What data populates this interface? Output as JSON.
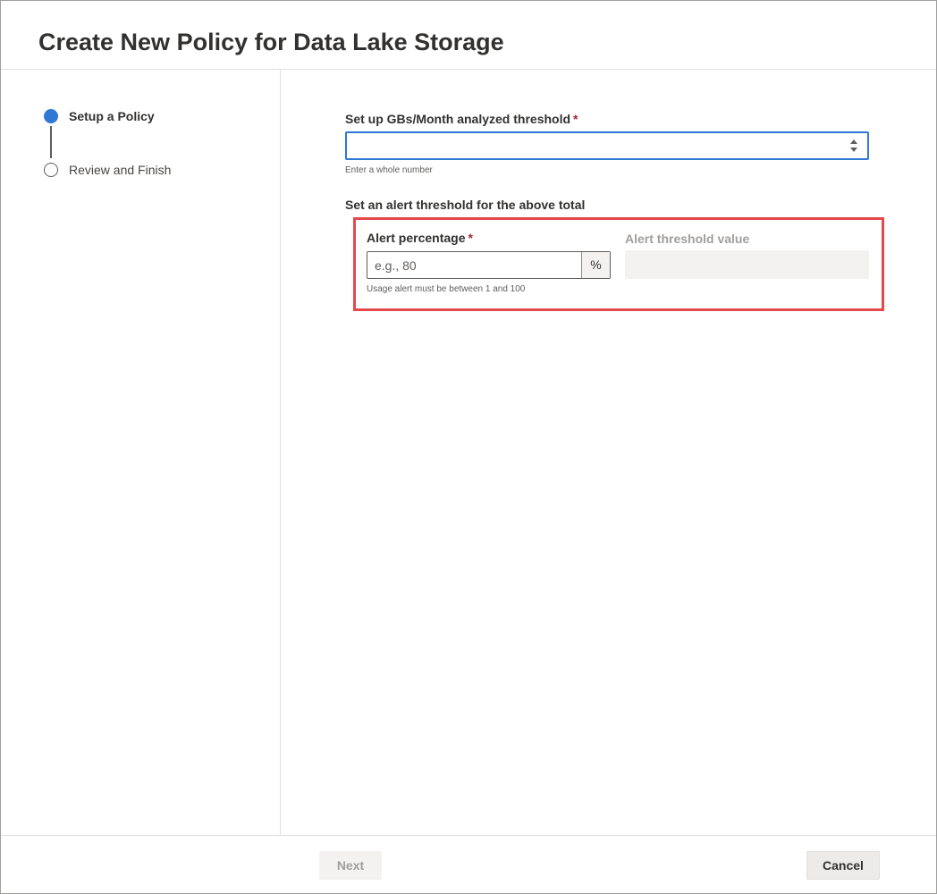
{
  "dialog": {
    "title": "Create New Policy for Data Lake Storage"
  },
  "steps": [
    {
      "label": "Setup a Policy",
      "state": "active"
    },
    {
      "label": "Review and Finish",
      "state": "pending"
    }
  ],
  "form": {
    "gb_threshold": {
      "label": "Set up GBs/Month analyzed threshold",
      "required_marker": "*",
      "value": "",
      "hint": "Enter a whole number"
    },
    "alert_section_title": "Set an alert threshold for the above total",
    "alert_percentage": {
      "label": "Alert percentage",
      "required_marker": "*",
      "placeholder": "e.g., 80",
      "suffix": "%",
      "hint": "Usage alert must be between 1 and 100"
    },
    "alert_threshold_value": {
      "label": "Alert threshold value",
      "value": ""
    }
  },
  "footer": {
    "next_label": "Next",
    "cancel_label": "Cancel"
  },
  "colors": {
    "accent": "#2f78d4",
    "required": "#a4262c",
    "highlight": "#e5484d"
  }
}
